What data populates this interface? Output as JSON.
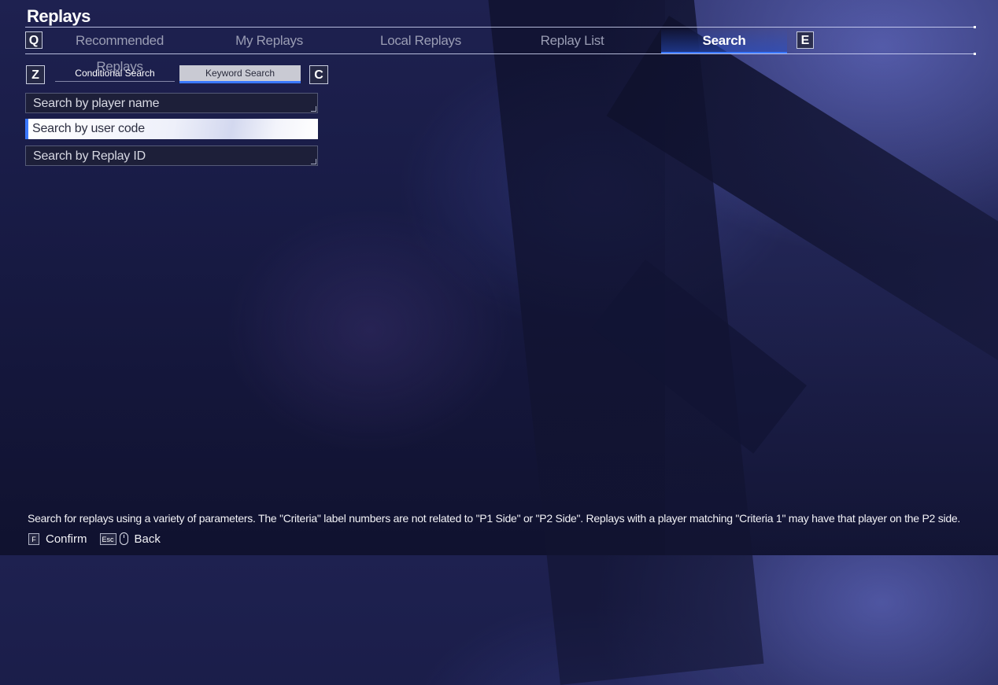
{
  "page": {
    "title": "Replays"
  },
  "tabs": {
    "prev_key": "Q",
    "next_key": "E",
    "items": [
      {
        "label": "Recommended Replays",
        "active": false
      },
      {
        "label": "My Replays",
        "active": false
      },
      {
        "label": "Local Replays",
        "active": false
      },
      {
        "label": "Replay List",
        "active": false
      },
      {
        "label": "Search",
        "active": true
      }
    ]
  },
  "subtabs": {
    "prev_key": "Z",
    "next_key": "C",
    "items": [
      {
        "label": "Conditional Search",
        "active": false
      },
      {
        "label": "Keyword Search",
        "active": true
      }
    ]
  },
  "search_fields": [
    {
      "placeholder": "Search by player name",
      "selected": false
    },
    {
      "placeholder": "Search by user code",
      "selected": true
    },
    {
      "placeholder": "Search by Replay ID",
      "selected": false
    }
  ],
  "footer": {
    "description": "Search for replays using a variety of parameters. The \"Criteria\" label numbers are not related to \"P1 Side\" or \"P2 Side\". Replays with a player matching \"Criteria 1\" may have that player on the P2 side.",
    "confirm_key": "F",
    "confirm_label": "Confirm",
    "back_key": "Esc",
    "back_label": "Back"
  },
  "colors": {
    "accent": "#3a78ff",
    "background": "#181b45"
  },
  "icons": {
    "back_mouse": "mouse-icon"
  }
}
